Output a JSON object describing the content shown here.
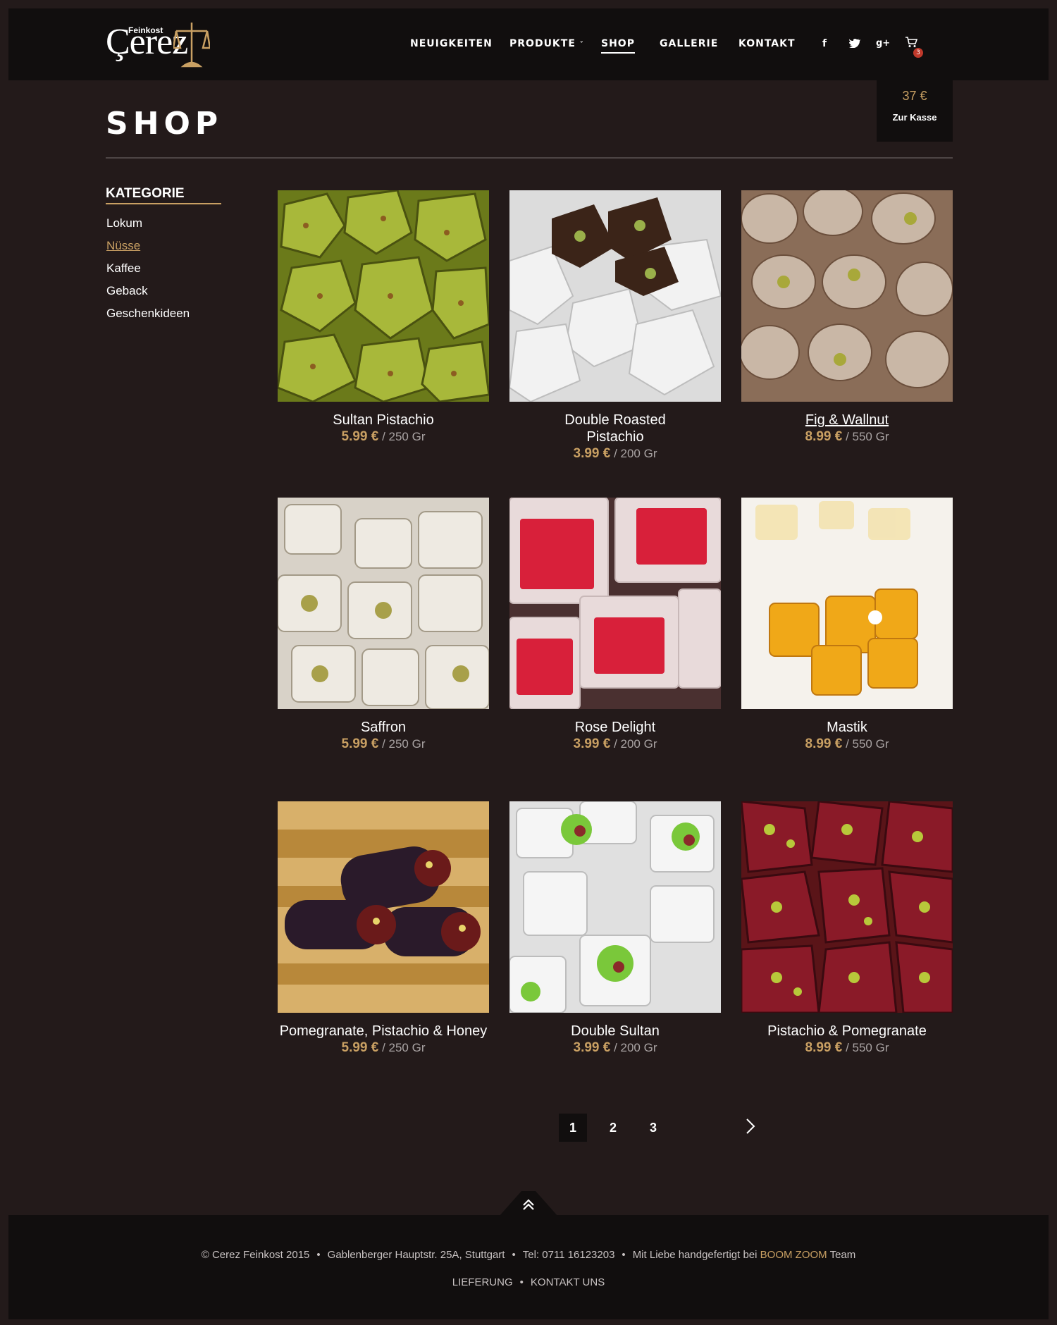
{
  "header": {
    "logo_small": "Feinkost",
    "logo_brand": "Çerez",
    "nav": [
      {
        "label": "NEUIGKEITEN"
      },
      {
        "label": "PRODUKTE"
      },
      {
        "label": "SHOP"
      },
      {
        "label": "GALLERIE"
      },
      {
        "label": "KONTAKT"
      }
    ],
    "nav_active": "SHOP",
    "produkte_chevron": "˅",
    "social": [
      {
        "icon": "facebook-icon",
        "glyph": "f"
      },
      {
        "icon": "twitter-icon",
        "glyph": "t"
      },
      {
        "icon": "google-plus-icon",
        "glyph": "g+"
      }
    ],
    "cart_count": "3"
  },
  "cart": {
    "total": "37 €",
    "checkout_label": "Zur Kasse"
  },
  "page_title": "SHOP",
  "sidebar": {
    "title": "KATEGORIE",
    "items": [
      {
        "label": "Lokum"
      },
      {
        "label": "Nüsse"
      },
      {
        "label": "Kaffee"
      },
      {
        "label": "Geback"
      },
      {
        "label": "Geschenkideen"
      }
    ],
    "active": "Nüsse"
  },
  "products": [
    {
      "name": "Sultan Pistachio",
      "price": "5.99 €",
      "unit": "/ 250 Gr"
    },
    {
      "name": "Double Roasted Pistachio",
      "price": "3.99 €",
      "unit": "/ 200 Gr"
    },
    {
      "name": "Fig & Wallnut",
      "price": "8.99 €",
      "unit": "/ 550 Gr"
    },
    {
      "name": "Saffron",
      "price": "5.99 €",
      "unit": "/ 250 Gr"
    },
    {
      "name": "Rose Delight",
      "price": "3.99 €",
      "unit": "/ 200 Gr"
    },
    {
      "name": "Mastik",
      "price": "8.99 €",
      "unit": "/ 550 Gr"
    },
    {
      "name": "Pomegranate, Pistachio & Honey",
      "price": "5.99 €",
      "unit": "/ 250 Gr"
    },
    {
      "name": "Double Sultan",
      "price": "3.99 €",
      "unit": "/ 200 Gr"
    },
    {
      "name": "Pistachio & Pomegranate",
      "price": "8.99 €",
      "unit": "/ 550 Gr"
    }
  ],
  "pagination": {
    "pages": [
      "1",
      "2",
      "3"
    ],
    "current": "1"
  },
  "footer": {
    "copyright": "© Cerez Feinkost 2015",
    "address": "Gablenberger Hauptstr. 25A, Stuttgart",
    "phone": "Tel: 0711 16123203",
    "credit_prefix": "Mit Liebe handgefertigt bei",
    "credit_brand": "BOOM ZOOM",
    "credit_suffix": "Team",
    "links": [
      {
        "label": "LIEFERUNG"
      },
      {
        "label": "KONTAKT UNS"
      }
    ],
    "separator": "•"
  },
  "colors": {
    "background": "#231a1a",
    "header": "#110e0e",
    "accent_gold": "#c9a063",
    "badge_red": "#c0392b"
  }
}
